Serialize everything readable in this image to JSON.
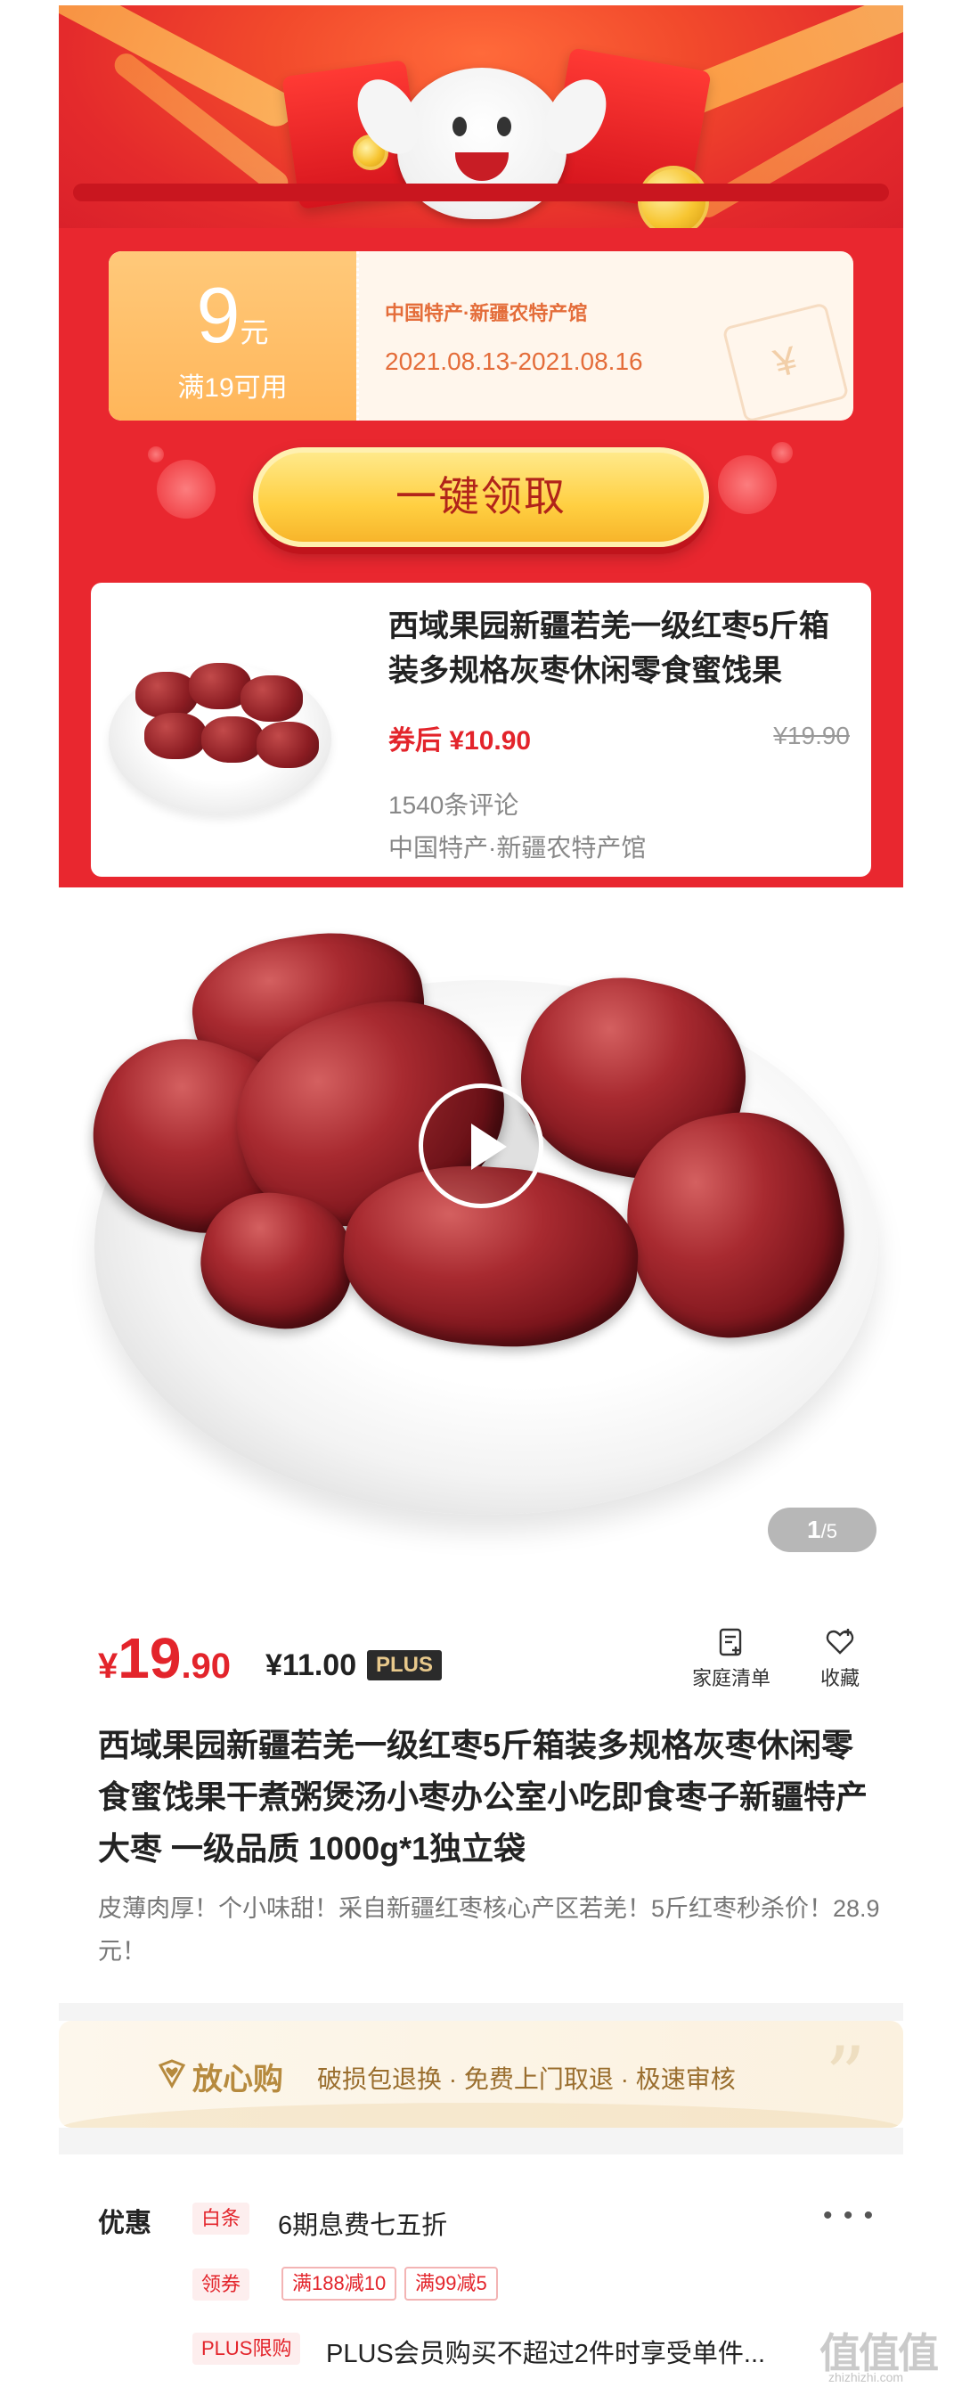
{
  "coupon": {
    "amount": "9",
    "unit": "元",
    "condition": "满19可用",
    "shop": "中国特产·新疆农特产馆",
    "validity": "2021.08.13-2021.08.16",
    "claim_label": "一键领取"
  },
  "coupon_product": {
    "title": "西域果园新疆若羌一级红枣5斤箱装多规格灰枣休闲零食蜜饯果",
    "after_coupon_label": "券后",
    "after_coupon_price": "¥10.90",
    "original_price": "¥19.90",
    "reviews": "1540条评论",
    "shop": "中国特产·新疆农特产馆"
  },
  "gallery": {
    "page_current": "1",
    "page_total": "/5"
  },
  "product": {
    "currency": "¥",
    "price_int": "19",
    "price_dec": ".90",
    "plus_price": "¥11.00",
    "plus_tag": "PLUS",
    "list_label": "家庭清单",
    "fav_label": "收藏",
    "title": "西域果园新疆若羌一级红枣5斤箱装多规格灰枣休闲零食蜜饯果干煮粥煲汤小枣办公室小吃即食枣子新疆特产大枣 一级品质 1000g*1独立袋",
    "description": "皮薄肉厚！个小味甜！采自新疆红枣核心产区若羌！5斤红枣秒杀价！28.9元！"
  },
  "assurance": {
    "title": "放心购",
    "text": "破损包退换 · 免费上门取退 · 极速审核"
  },
  "promotions": {
    "label": "优惠",
    "baitiao_tag": "白条",
    "baitiao_text": "6期息费七五折",
    "coupon_tag": "领券",
    "coupon_chips": [
      "满188减10",
      "满99减5"
    ],
    "plus_tag": "PLUS限购",
    "plus_text": "PLUS会员购买不超过2件时享受单件..."
  },
  "watermark": {
    "logo": "值值值",
    "site": "zhizhizhi.com"
  },
  "colors": {
    "brand_red": "#e3242b",
    "coupon_gold": "#ffc97a",
    "plus_gold": "#e8c98c"
  }
}
